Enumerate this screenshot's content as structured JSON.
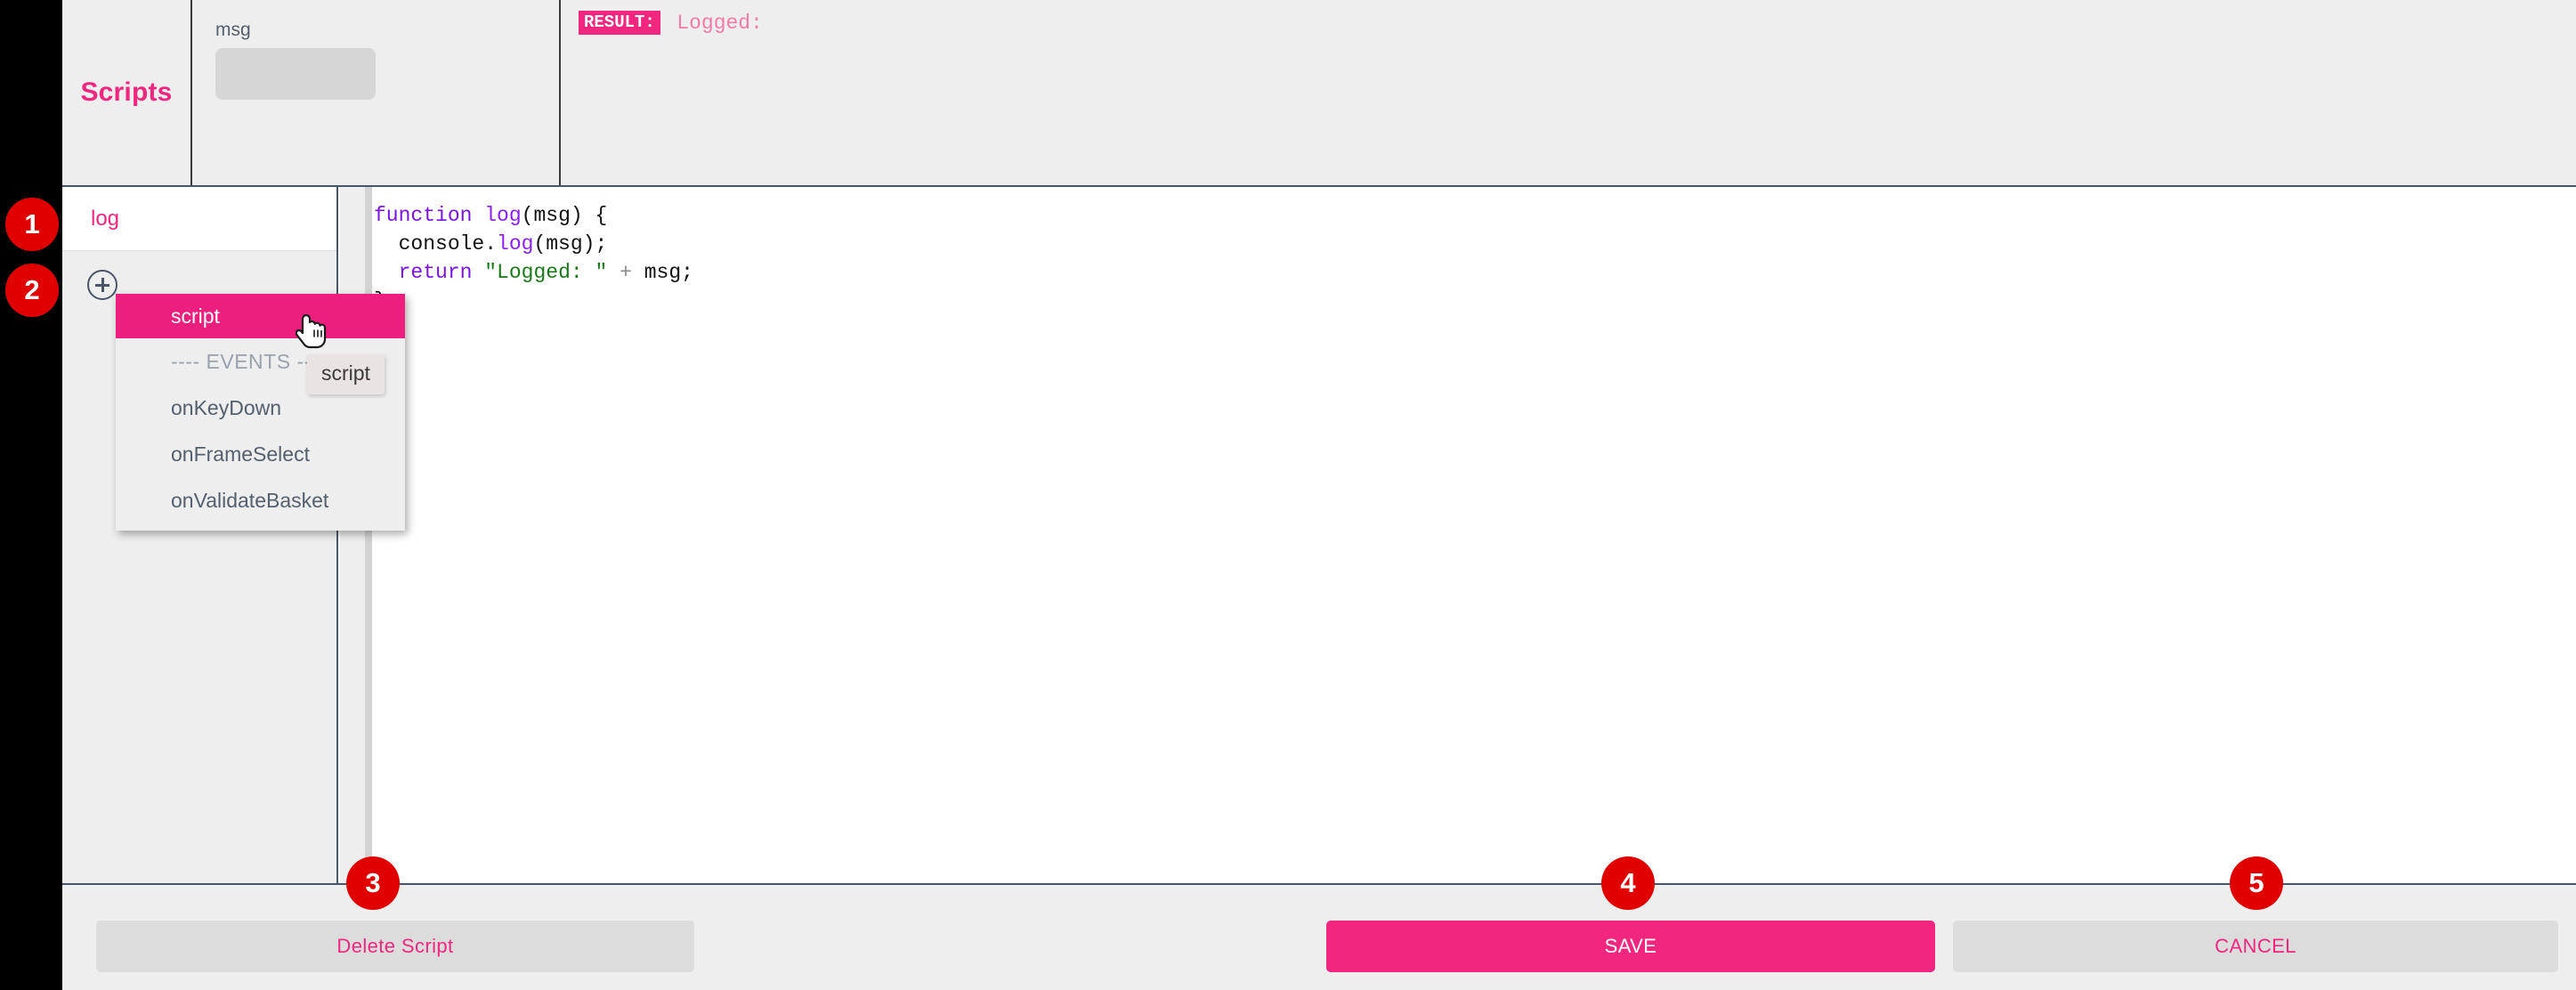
{
  "header": {
    "title": "Scripts",
    "param": {
      "label": "msg",
      "value": "",
      "placeholder": ""
    },
    "result": {
      "badge": "RESULT:",
      "text": "Logged:"
    }
  },
  "script_list": {
    "items": [
      {
        "label": "log"
      }
    ],
    "add_button_icon": "plus-circle-icon"
  },
  "dropdown": {
    "items": [
      {
        "label": "script",
        "selected": true,
        "kind": "option"
      },
      {
        "label": "---- EVENTS ----",
        "selected": false,
        "kind": "separator"
      },
      {
        "label": "onKeyDown",
        "selected": false,
        "kind": "option"
      },
      {
        "label": "onFrameSelect",
        "selected": false,
        "kind": "option"
      },
      {
        "label": "onValidateBasket",
        "selected": false,
        "kind": "option"
      }
    ]
  },
  "tooltip": {
    "text": "script"
  },
  "cursor": {
    "icon": "pointing-hand-cursor"
  },
  "editor": {
    "lines": [
      [
        {
          "t": "function",
          "c": "kw"
        },
        {
          "t": " ",
          "c": "plain"
        },
        {
          "t": "log",
          "c": "fn"
        },
        {
          "t": "(msg) {",
          "c": "plain"
        }
      ],
      [
        {
          "t": "  console.",
          "c": "plain"
        },
        {
          "t": "log",
          "c": "fn"
        },
        {
          "t": "(msg);",
          "c": "plain"
        }
      ],
      [
        {
          "t": "  ",
          "c": "plain"
        },
        {
          "t": "return",
          "c": "kw"
        },
        {
          "t": " ",
          "c": "plain"
        },
        {
          "t": "\"Logged: \"",
          "c": "str"
        },
        {
          "t": " ",
          "c": "plain"
        },
        {
          "t": "+",
          "c": "op"
        },
        {
          "t": " msg;",
          "c": "plain"
        }
      ],
      [
        {
          "t": "}",
          "c": "plain"
        }
      ]
    ]
  },
  "footer": {
    "delete_label": "Delete Script",
    "save_label": "SAVE",
    "cancel_label": "CANCEL"
  },
  "step_badges": [
    {
      "n": "1"
    },
    {
      "n": "2"
    },
    {
      "n": "3"
    },
    {
      "n": "4"
    },
    {
      "n": "5"
    }
  ],
  "colors": {
    "accent_pink": "#f1277f",
    "menu_pink": "#ec1f7e",
    "badge_red": "#e00000",
    "panel_gray": "#eeeeee",
    "divider": "#4a5568",
    "code_keyword": "#7b14e0",
    "code_string": "#1a7a1a"
  }
}
